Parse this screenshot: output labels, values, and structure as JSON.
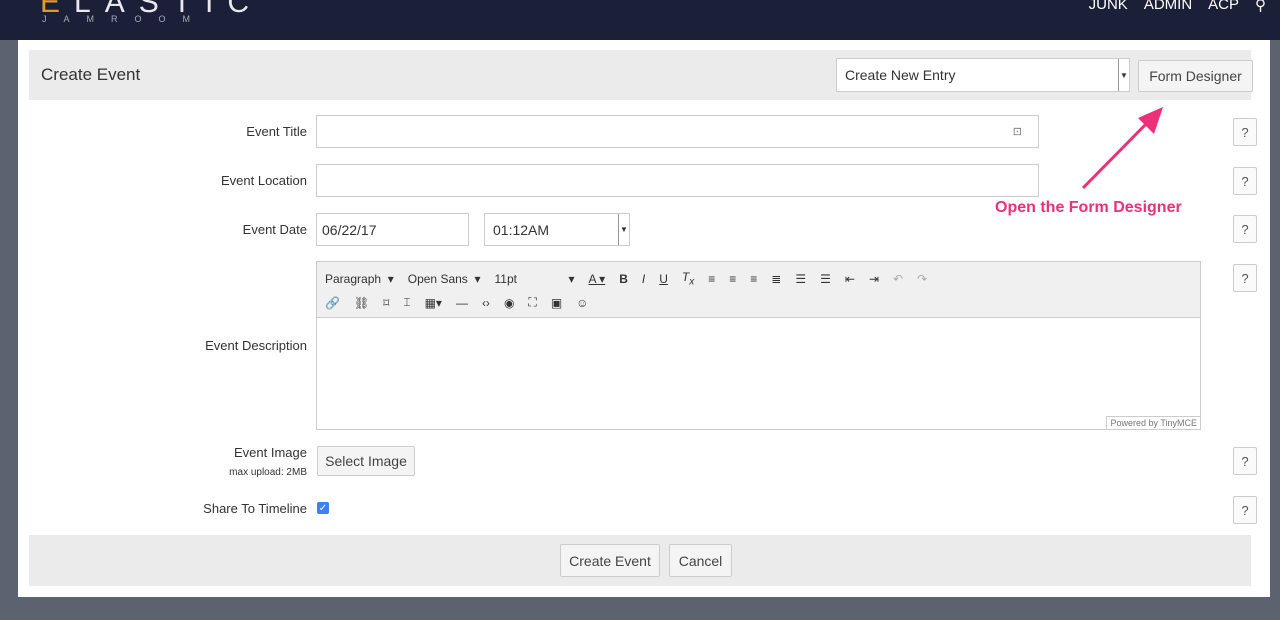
{
  "nav": {
    "logo": "ELASTIC",
    "logo_sub": "JAMROOM",
    "links": [
      "JUNK",
      "ADMIN",
      "ACP"
    ],
    "search_icon": "search-icon"
  },
  "header": {
    "title": "Create Event",
    "select_value": "Create New Entry",
    "form_designer": "Form Designer"
  },
  "fields": {
    "title_label": "Event Title",
    "location_label": "Event Location",
    "date_label": "Event Date",
    "date_value": "06/22/17",
    "time_value": "01:12AM",
    "description_label": "Event Description",
    "image_label": "Event Image",
    "image_hint": "max upload: 2MB",
    "select_image": "Select Image",
    "share_label": "Share To Timeline",
    "share_checked": true
  },
  "editor": {
    "format": "Paragraph",
    "font": "Open Sans",
    "size": "11pt",
    "powered": "Powered by TinyMCE"
  },
  "help": "?",
  "footer": {
    "submit": "Create Event",
    "cancel": "Cancel"
  },
  "annotation": {
    "text": "Open the Form Designer",
    "color": "#ee2f79"
  }
}
